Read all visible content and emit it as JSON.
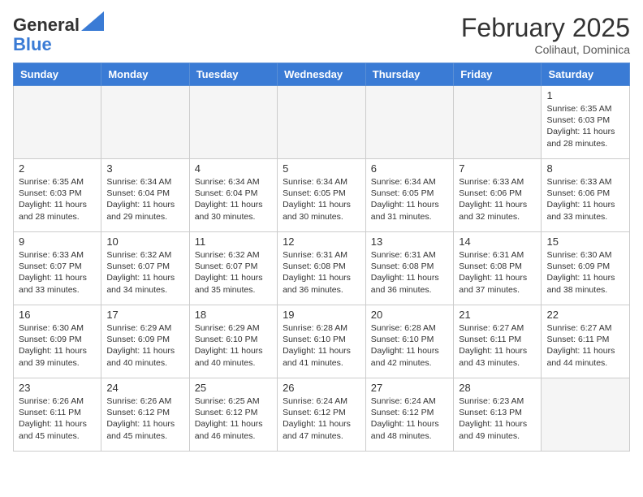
{
  "header": {
    "logo_general": "General",
    "logo_blue": "Blue",
    "month_title": "February 2025",
    "subtitle": "Colihaut, Dominica"
  },
  "days_of_week": [
    "Sunday",
    "Monday",
    "Tuesday",
    "Wednesday",
    "Thursday",
    "Friday",
    "Saturday"
  ],
  "weeks": [
    [
      {
        "day": "",
        "info": ""
      },
      {
        "day": "",
        "info": ""
      },
      {
        "day": "",
        "info": ""
      },
      {
        "day": "",
        "info": ""
      },
      {
        "day": "",
        "info": ""
      },
      {
        "day": "",
        "info": ""
      },
      {
        "day": "1",
        "info": "Sunrise: 6:35 AM\nSunset: 6:03 PM\nDaylight: 11 hours and 28 minutes."
      }
    ],
    [
      {
        "day": "2",
        "info": "Sunrise: 6:35 AM\nSunset: 6:03 PM\nDaylight: 11 hours and 28 minutes."
      },
      {
        "day": "3",
        "info": "Sunrise: 6:34 AM\nSunset: 6:04 PM\nDaylight: 11 hours and 29 minutes."
      },
      {
        "day": "4",
        "info": "Sunrise: 6:34 AM\nSunset: 6:04 PM\nDaylight: 11 hours and 30 minutes."
      },
      {
        "day": "5",
        "info": "Sunrise: 6:34 AM\nSunset: 6:05 PM\nDaylight: 11 hours and 30 minutes."
      },
      {
        "day": "6",
        "info": "Sunrise: 6:34 AM\nSunset: 6:05 PM\nDaylight: 11 hours and 31 minutes."
      },
      {
        "day": "7",
        "info": "Sunrise: 6:33 AM\nSunset: 6:06 PM\nDaylight: 11 hours and 32 minutes."
      },
      {
        "day": "8",
        "info": "Sunrise: 6:33 AM\nSunset: 6:06 PM\nDaylight: 11 hours and 33 minutes."
      }
    ],
    [
      {
        "day": "9",
        "info": "Sunrise: 6:33 AM\nSunset: 6:07 PM\nDaylight: 11 hours and 33 minutes."
      },
      {
        "day": "10",
        "info": "Sunrise: 6:32 AM\nSunset: 6:07 PM\nDaylight: 11 hours and 34 minutes."
      },
      {
        "day": "11",
        "info": "Sunrise: 6:32 AM\nSunset: 6:07 PM\nDaylight: 11 hours and 35 minutes."
      },
      {
        "day": "12",
        "info": "Sunrise: 6:31 AM\nSunset: 6:08 PM\nDaylight: 11 hours and 36 minutes."
      },
      {
        "day": "13",
        "info": "Sunrise: 6:31 AM\nSunset: 6:08 PM\nDaylight: 11 hours and 36 minutes."
      },
      {
        "day": "14",
        "info": "Sunrise: 6:31 AM\nSunset: 6:08 PM\nDaylight: 11 hours and 37 minutes."
      },
      {
        "day": "15",
        "info": "Sunrise: 6:30 AM\nSunset: 6:09 PM\nDaylight: 11 hours and 38 minutes."
      }
    ],
    [
      {
        "day": "16",
        "info": "Sunrise: 6:30 AM\nSunset: 6:09 PM\nDaylight: 11 hours and 39 minutes."
      },
      {
        "day": "17",
        "info": "Sunrise: 6:29 AM\nSunset: 6:09 PM\nDaylight: 11 hours and 40 minutes."
      },
      {
        "day": "18",
        "info": "Sunrise: 6:29 AM\nSunset: 6:10 PM\nDaylight: 11 hours and 40 minutes."
      },
      {
        "day": "19",
        "info": "Sunrise: 6:28 AM\nSunset: 6:10 PM\nDaylight: 11 hours and 41 minutes."
      },
      {
        "day": "20",
        "info": "Sunrise: 6:28 AM\nSunset: 6:10 PM\nDaylight: 11 hours and 42 minutes."
      },
      {
        "day": "21",
        "info": "Sunrise: 6:27 AM\nSunset: 6:11 PM\nDaylight: 11 hours and 43 minutes."
      },
      {
        "day": "22",
        "info": "Sunrise: 6:27 AM\nSunset: 6:11 PM\nDaylight: 11 hours and 44 minutes."
      }
    ],
    [
      {
        "day": "23",
        "info": "Sunrise: 6:26 AM\nSunset: 6:11 PM\nDaylight: 11 hours and 45 minutes."
      },
      {
        "day": "24",
        "info": "Sunrise: 6:26 AM\nSunset: 6:12 PM\nDaylight: 11 hours and 45 minutes."
      },
      {
        "day": "25",
        "info": "Sunrise: 6:25 AM\nSunset: 6:12 PM\nDaylight: 11 hours and 46 minutes."
      },
      {
        "day": "26",
        "info": "Sunrise: 6:24 AM\nSunset: 6:12 PM\nDaylight: 11 hours and 47 minutes."
      },
      {
        "day": "27",
        "info": "Sunrise: 6:24 AM\nSunset: 6:12 PM\nDaylight: 11 hours and 48 minutes."
      },
      {
        "day": "28",
        "info": "Sunrise: 6:23 AM\nSunset: 6:13 PM\nDaylight: 11 hours and 49 minutes."
      },
      {
        "day": "",
        "info": ""
      }
    ]
  ]
}
